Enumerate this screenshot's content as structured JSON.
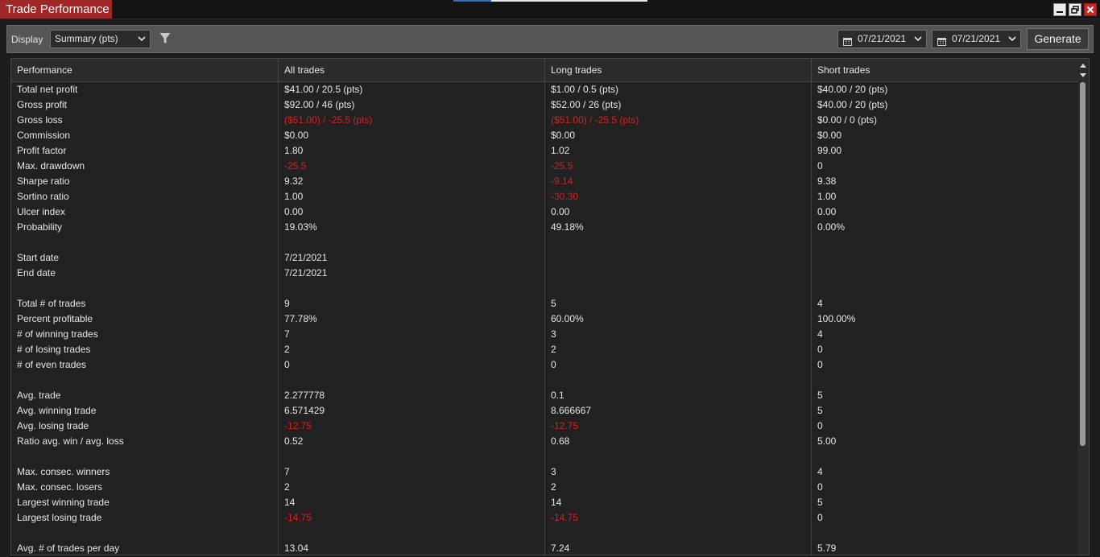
{
  "window": {
    "title": "Trade Performance"
  },
  "toolbar": {
    "display_label": "Display",
    "display_value": "Summary (pts)",
    "date_from": "07/21/2021",
    "date_to": "07/21/2021",
    "generate_label": "Generate"
  },
  "colors": {
    "title_bar": "#a12727",
    "negative": "#d62020",
    "generate_border": "#3d7bc4"
  },
  "table": {
    "headers": [
      "Performance",
      "All trades",
      "Long trades",
      "Short trades"
    ],
    "rows": [
      {
        "cells": [
          "Total net profit",
          "$41.00 / 20.5 (pts)",
          "$1.00 / 0.5 (pts)",
          "$40.00 / 20 (pts)"
        ],
        "neg": [
          false,
          false,
          false,
          false
        ]
      },
      {
        "cells": [
          "Gross profit",
          "$92.00 / 46 (pts)",
          "$52.00 / 26 (pts)",
          "$40.00 / 20 (pts)"
        ],
        "neg": [
          false,
          false,
          false,
          false
        ]
      },
      {
        "cells": [
          "Gross loss",
          "($51.00) / -25.5 (pts)",
          "($51.00) / -25.5 (pts)",
          "$0.00 / 0 (pts)"
        ],
        "neg": [
          false,
          true,
          true,
          false
        ]
      },
      {
        "cells": [
          "Commission",
          "$0.00",
          "$0.00",
          "$0.00"
        ],
        "neg": [
          false,
          false,
          false,
          false
        ]
      },
      {
        "cells": [
          "Profit factor",
          "1.80",
          "1.02",
          "99.00"
        ],
        "neg": [
          false,
          false,
          false,
          false
        ]
      },
      {
        "cells": [
          "Max. drawdown",
          "-25.5",
          "-25.5",
          "0"
        ],
        "neg": [
          false,
          true,
          true,
          false
        ]
      },
      {
        "cells": [
          "Sharpe ratio",
          "9.32",
          "-9.14",
          "9.38"
        ],
        "neg": [
          false,
          false,
          true,
          false
        ]
      },
      {
        "cells": [
          "Sortino ratio",
          "1.00",
          "-30.30",
          "1.00"
        ],
        "neg": [
          false,
          false,
          true,
          false
        ]
      },
      {
        "cells": [
          "Ulcer index",
          "0.00",
          "0.00",
          "0.00"
        ],
        "neg": [
          false,
          false,
          false,
          false
        ]
      },
      {
        "cells": [
          "Probability",
          "19.03%",
          "49.18%",
          "0.00%"
        ],
        "neg": [
          false,
          false,
          false,
          false
        ]
      },
      {
        "cells": [
          "",
          "",
          "",
          ""
        ],
        "neg": [
          false,
          false,
          false,
          false
        ]
      },
      {
        "cells": [
          "Start date",
          "7/21/2021",
          "",
          ""
        ],
        "neg": [
          false,
          false,
          false,
          false
        ]
      },
      {
        "cells": [
          "End date",
          "7/21/2021",
          "",
          ""
        ],
        "neg": [
          false,
          false,
          false,
          false
        ]
      },
      {
        "cells": [
          "",
          "",
          "",
          ""
        ],
        "neg": [
          false,
          false,
          false,
          false
        ]
      },
      {
        "cells": [
          "Total # of trades",
          "9",
          "5",
          "4"
        ],
        "neg": [
          false,
          false,
          false,
          false
        ]
      },
      {
        "cells": [
          "Percent profitable",
          "77.78%",
          "60.00%",
          "100.00%"
        ],
        "neg": [
          false,
          false,
          false,
          false
        ]
      },
      {
        "cells": [
          "# of winning trades",
          "7",
          "3",
          "4"
        ],
        "neg": [
          false,
          false,
          false,
          false
        ]
      },
      {
        "cells": [
          "# of losing trades",
          "2",
          "2",
          "0"
        ],
        "neg": [
          false,
          false,
          false,
          false
        ]
      },
      {
        "cells": [
          "# of even trades",
          "0",
          "0",
          "0"
        ],
        "neg": [
          false,
          false,
          false,
          false
        ]
      },
      {
        "cells": [
          "",
          "",
          "",
          ""
        ],
        "neg": [
          false,
          false,
          false,
          false
        ]
      },
      {
        "cells": [
          "Avg. trade",
          "2.277778",
          "0.1",
          "5"
        ],
        "neg": [
          false,
          false,
          false,
          false
        ]
      },
      {
        "cells": [
          "Avg. winning trade",
          "6.571429",
          "8.666667",
          "5"
        ],
        "neg": [
          false,
          false,
          false,
          false
        ]
      },
      {
        "cells": [
          "Avg. losing trade",
          "-12.75",
          "-12.75",
          "0"
        ],
        "neg": [
          false,
          true,
          true,
          false
        ]
      },
      {
        "cells": [
          "Ratio avg. win / avg. loss",
          "0.52",
          "0.68",
          "5.00"
        ],
        "neg": [
          false,
          false,
          false,
          false
        ]
      },
      {
        "cells": [
          "",
          "",
          "",
          ""
        ],
        "neg": [
          false,
          false,
          false,
          false
        ]
      },
      {
        "cells": [
          "Max. consec. winners",
          "7",
          "3",
          "4"
        ],
        "neg": [
          false,
          false,
          false,
          false
        ]
      },
      {
        "cells": [
          "Max. consec. losers",
          "2",
          "2",
          "0"
        ],
        "neg": [
          false,
          false,
          false,
          false
        ]
      },
      {
        "cells": [
          "Largest winning trade",
          "14",
          "14",
          "5"
        ],
        "neg": [
          false,
          false,
          false,
          false
        ]
      },
      {
        "cells": [
          "Largest losing trade",
          "-14.75",
          "-14.75",
          "0"
        ],
        "neg": [
          false,
          true,
          true,
          false
        ]
      },
      {
        "cells": [
          "",
          "",
          "",
          ""
        ],
        "neg": [
          false,
          false,
          false,
          false
        ]
      },
      {
        "cells": [
          "Avg. # of trades per day",
          "13.04",
          "7.24",
          "5.79"
        ],
        "neg": [
          false,
          false,
          false,
          false
        ]
      }
    ]
  }
}
